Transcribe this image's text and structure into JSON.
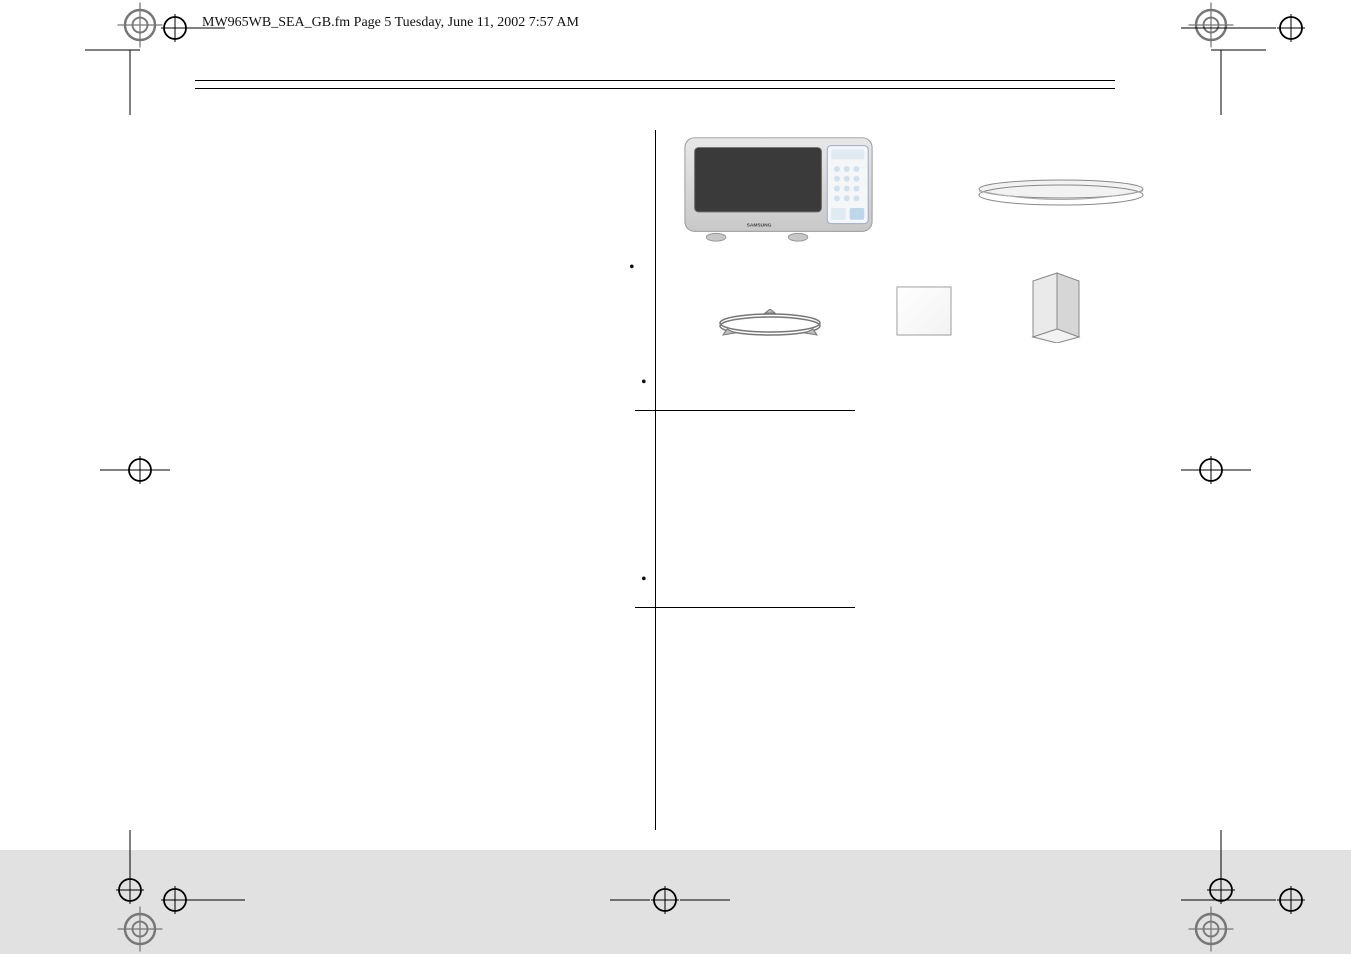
{
  "header": {
    "running_text": "MW965WB_SEA_GB.fm  Page 5  Tuesday, June 11, 2002  7:57 AM"
  },
  "product": {
    "brand_label": "SAMSUNG"
  },
  "icons": {
    "microwave": "microwave-oven-front",
    "glass_tray": "turntable-glass-tray",
    "roller_ring": "roller-ring",
    "warranty_card": "square-card",
    "manual": "instruction-booklet",
    "reg_circle": "printer-registration-circle",
    "reg_cross": "printer-crosshair"
  }
}
